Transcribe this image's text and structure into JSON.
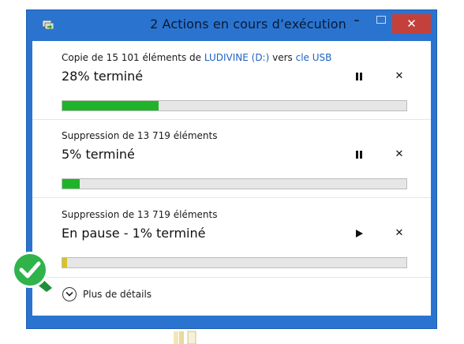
{
  "window": {
    "title": "2 Actions en cours d’exécution",
    "minimize_label": "–",
    "close_label": "✕"
  },
  "operations": [
    {
      "desc_prefix": "Copie de 15 101 éléments de ",
      "source": "LUDIVINE (D:)",
      "desc_middle": " vers ",
      "destination": "cle USB",
      "status": "28% terminé",
      "progress_percent": 28,
      "progress_color": "#1fb329",
      "state": "running"
    },
    {
      "desc": "Suppression de 13 719 éléments",
      "status": "5% terminé",
      "progress_percent": 5,
      "progress_color": "#1fb329",
      "state": "running"
    },
    {
      "desc": "Suppression de 13 719 éléments",
      "status": "En pause - 1% terminé",
      "progress_percent": 1,
      "progress_color": "#d6c22a",
      "state": "paused"
    }
  ],
  "details": {
    "label": "Plus de détails"
  },
  "colors": {
    "frame": "#2a74d0",
    "link": "#1e62c2",
    "close_button": "#c4403a",
    "badge": "#2fb34a"
  }
}
